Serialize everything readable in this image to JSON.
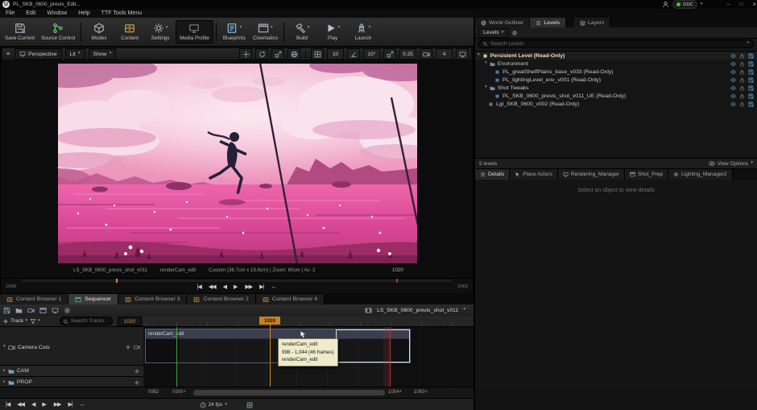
{
  "glyphs": {
    "dropdown": "▾",
    "caret_right": "▸",
    "to_start": "|◀",
    "fast_back": "◀◀",
    "step_back": "◀",
    "play": "▶",
    "fast_fwd": "▶▶",
    "to_end": "▶|",
    "loop": "↔",
    "burger": "≡",
    "minimize": "–",
    "maximize": "□",
    "close": "×",
    "plus": "+"
  },
  "titlebar": {
    "logo": "U",
    "title": "PL_SKB_0600_previs_Edit...",
    "ddc": "DDC"
  },
  "menubar": {
    "items": [
      "File",
      "Edit",
      "Window",
      "Help",
      "TTF Tools Menu"
    ]
  },
  "toolbar": {
    "buttons": [
      {
        "label": "Save Current"
      },
      {
        "label": "Source Control"
      },
      {
        "label": "Modes"
      },
      {
        "label": "Content"
      },
      {
        "label": "Settings"
      },
      {
        "label": "Media Profile"
      },
      {
        "label": "Blueprints"
      },
      {
        "label": "Cinematics"
      },
      {
        "label": "Build"
      },
      {
        "label": "Play"
      },
      {
        "label": "Launch"
      }
    ]
  },
  "viewport": {
    "perspective": "Perspective",
    "lit": "Lit",
    "show": "Show",
    "grid_snap": "10",
    "rotation_snap": "10°",
    "scale_snap": "0.25",
    "camera_speed": "4",
    "footer_sequence": "LS_SKB_0600_previs_shot_v011",
    "footer_shot": "renderCam_edit",
    "footer_camera": "Custom (36.7cm x 19.8cm) | Zoom: 60cm | Av: 2",
    "footer_frame": "1020",
    "range_start": "1008",
    "range_end": "1063"
  },
  "outliner": {
    "tabs": [
      {
        "label": "World Outliner"
      },
      {
        "label": "Levels"
      },
      {
        "label": "Layers"
      }
    ],
    "levels_button": "Levels",
    "search_placeholder": "Search Levels",
    "rows": [
      {
        "label": "Persistent Level (Read-Only)"
      },
      {
        "label": "Environment"
      },
      {
        "label": "PL_greatShelfPlains_base_v033 (Read-Only)"
      },
      {
        "label": "PL_lightingLevel_env_v001 (Read-Only)"
      },
      {
        "label": "Shot Tweaks"
      },
      {
        "label": "PL_SKB_0600_previs_shot_v011_UE (Read-Only)"
      },
      {
        "label": "Lgt_SKB_0600_v002 (Read-Only)"
      }
    ],
    "status": "5 levels",
    "view_options": "View Options"
  },
  "details": {
    "tabs": [
      {
        "label": "Details"
      },
      {
        "label": "Place Actors"
      },
      {
        "label": "Rendering_Manager"
      },
      {
        "label": "Shot_Prep"
      },
      {
        "label": "Lighting_Manager2"
      }
    ],
    "empty_message": "Select an object to view details"
  },
  "bottom_tabs": [
    {
      "label": "Content Browser 1"
    },
    {
      "label": "Sequencer"
    },
    {
      "label": "Content Browser 3"
    },
    {
      "label": "Content Browser 2"
    },
    {
      "label": "Content Browser 4"
    }
  ],
  "sequencer": {
    "breadcrumb": "LS_SKB_0600_previs_shot_v011",
    "track_button": "Track",
    "filters_button": "Filters",
    "search_placeholder": "Search Tracks",
    "current_frame": "1020",
    "tracks": {
      "camera_cuts": "Camera Cuts",
      "cam": "CAM",
      "prop": "PROP"
    },
    "clip_label": "renderCam_edit",
    "tooltip": {
      "line1": "renderCam_edit",
      "line2": "998 - 1,044 (46 frames)",
      "line3": "renderCam_edit"
    },
    "footer": {
      "start": "0982",
      "range_in": "0989+",
      "fps": "24 fps",
      "range_out": "1054+",
      "end": "1063+"
    }
  }
}
